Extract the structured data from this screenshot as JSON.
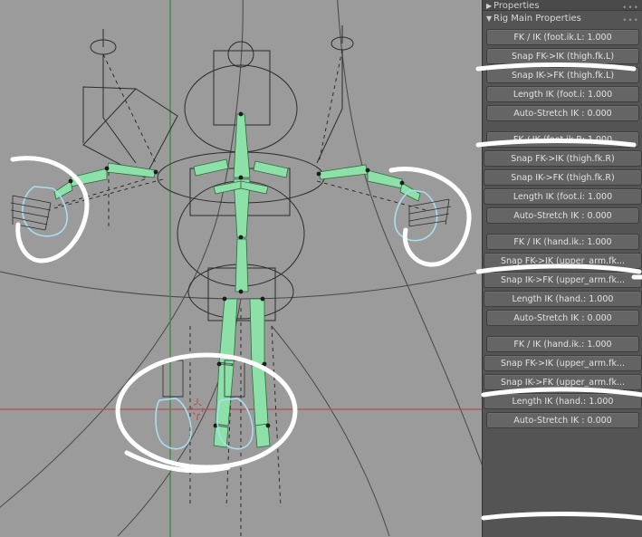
{
  "window": {
    "title": "Blender 3D viewport with armature rig and Rig Main Properties panel"
  },
  "panel": {
    "collapsed_header": {
      "label": "Properties",
      "triangle": "▶",
      "dots": "•••"
    },
    "expanded_header": {
      "label": "Rig Main Properties",
      "triangle": "▼",
      "dots": "•••"
    },
    "groups": [
      {
        "name": "foot-ik-left",
        "buttons": [
          {
            "name": "fk-ik-foot-ik-l",
            "label": "FK / IK (foot.ik.L: 1.000"
          },
          {
            "name": "snap-fk-to-ik-thigh-fk-l",
            "label": "Snap FK->IK (thigh.fk.L)"
          },
          {
            "name": "snap-ik-to-fk-thigh-fk-l",
            "label": "Snap IK->FK (thigh.fk.L)"
          },
          {
            "name": "length-ik-foot-i-l",
            "label": "Length IK (foot.i: 1.000"
          },
          {
            "name": "auto-stretch-ik-l",
            "label": "Auto-Stretch IK : 0.000"
          }
        ]
      },
      {
        "name": "foot-ik-right",
        "buttons": [
          {
            "name": "fk-ik-foot-ik-r",
            "label": "FK / IK (foot.ik.R: 1.000"
          },
          {
            "name": "snap-fk-to-ik-thigh-fk-r",
            "label": "Snap FK->IK (thigh.fk.R)"
          },
          {
            "name": "snap-ik-to-fk-thigh-fk-r",
            "label": "Snap IK->FK (thigh.fk.R)"
          },
          {
            "name": "length-ik-foot-i-r",
            "label": "Length IK (foot.i: 1.000"
          },
          {
            "name": "auto-stretch-ik-r",
            "label": "Auto-Stretch IK : 0.000"
          }
        ]
      },
      {
        "name": "hand-ik-left",
        "buttons": [
          {
            "name": "fk-ik-hand-ik-l",
            "label": "FK / IK (hand.ik.: 1.000"
          },
          {
            "name": "snap-fk-to-ik-upper-arm-fk-l",
            "label": "Snap FK->IK (upper_arm.fk..."
          },
          {
            "name": "snap-ik-to-fk-upper-arm-fk-l",
            "label": "Snap IK->FK (upper_arm.fk..."
          },
          {
            "name": "length-ik-hand-l",
            "label": "Length IK (hand.: 1.000"
          },
          {
            "name": "auto-stretch-ik-hand-l",
            "label": "Auto-Stretch IK : 0.000"
          }
        ]
      },
      {
        "name": "hand-ik-right",
        "buttons": [
          {
            "name": "fk-ik-hand-ik-r",
            "label": "FK / IK (hand.ik.: 1.000"
          },
          {
            "name": "snap-fk-to-ik-upper-arm-fk-r",
            "label": "Snap FK->IK (upper_arm.fk..."
          },
          {
            "name": "snap-ik-to-fk-upper-arm-fk-r",
            "label": "Snap IK->FK (upper_arm.fk..."
          },
          {
            "name": "length-ik-hand-r",
            "label": "Length IK (hand.: 1.000"
          },
          {
            "name": "auto-stretch-ik-hand-r",
            "label": "Auto-Stretch IK : 0.000"
          }
        ]
      }
    ]
  },
  "viewport": {
    "background_color": "#9b9b9b",
    "bone_color": "#8ce0a8",
    "selected_color": "#a8dff0",
    "axis_green": "#3f8f3f",
    "axis_red": "#b05050",
    "wire_color": "#2a2a2a",
    "annotation_color": "#ffffff",
    "annotation_count": 4
  }
}
